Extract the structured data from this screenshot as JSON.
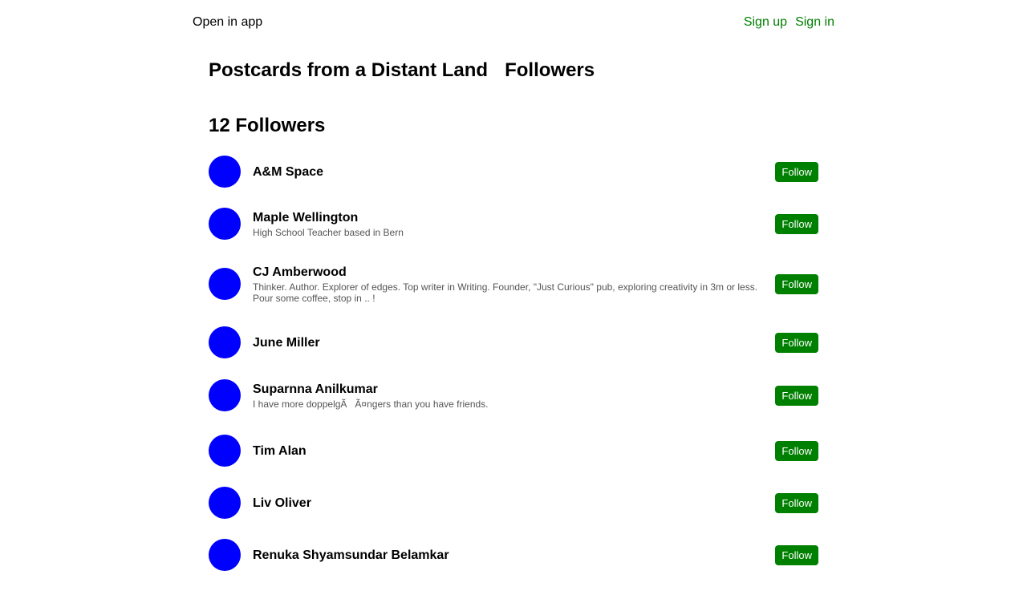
{
  "topbar": {
    "open_in_app": "Open in app",
    "sign_up": "Sign up",
    "sign_in": "Sign in"
  },
  "header": {
    "publication_title": "Postcards from a Distant Land",
    "section_title": "Followers"
  },
  "followers": {
    "count_title": "12 Followers",
    "follow_label": "Follow",
    "items": [
      {
        "name": "A&M Space",
        "bio": ""
      },
      {
        "name": "Maple Wellington",
        "bio": "High School Teacher based in Bern"
      },
      {
        "name": "CJ Amberwood",
        "bio": "Thinker. Author. Explorer of edges. Top writer in Writing. Founder, \"Just Curious\" pub, exploring creativity in 3m or less. Pour some coffee, stop in .. !"
      },
      {
        "name": "June Miller",
        "bio": ""
      },
      {
        "name": "Suparnna Anilkumar",
        "bio": "I have more doppelgÃ   Ã¤ngers than you have friends."
      },
      {
        "name": "Tim Alan",
        "bio": ""
      },
      {
        "name": "Liv Oliver",
        "bio": ""
      },
      {
        "name": "Renuka Shyamsundar Belamkar",
        "bio": ""
      }
    ]
  },
  "colors": {
    "link": "#008000",
    "button_bg": "#008000",
    "avatar": "#0000ff"
  }
}
